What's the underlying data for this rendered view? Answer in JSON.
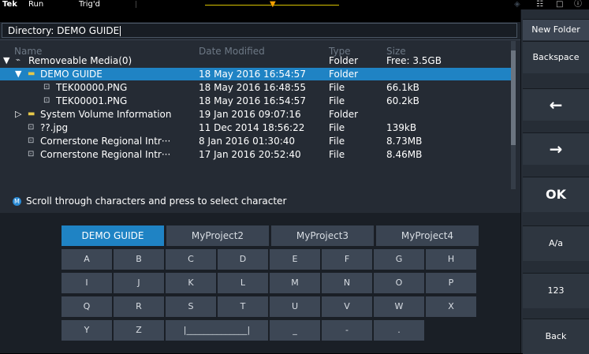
{
  "status_bar": {
    "logo": "Tek",
    "run_state": "Run",
    "trigger_state": "Trig'd",
    "trigger_marker": "T"
  },
  "directory": {
    "label": "Directory: DEMO GUIDE"
  },
  "file_table": {
    "headers": {
      "name": "Name",
      "date": "Date Modified",
      "type": "Type",
      "size": "Size"
    },
    "rows": [
      {
        "name": "Removeable Media(0)",
        "date": "",
        "type": "Folder",
        "size": "Free: 3.5GB",
        "indent": 0,
        "expander": "▼",
        "icon": "drive"
      },
      {
        "name": "DEMO GUIDE",
        "date": "18 May 2016 16:54:57",
        "type": "Folder",
        "size": "",
        "indent": 1,
        "expander": "▼",
        "icon": "folder",
        "selected": true
      },
      {
        "name": "TEK00000.PNG",
        "date": "18 May 2016 16:48:55",
        "type": "File",
        "size": "66.1kB",
        "indent": 2,
        "expander": "",
        "icon": "image"
      },
      {
        "name": "TEK00001.PNG",
        "date": "18 May 2016 16:54:57",
        "type": "File",
        "size": "60.2kB",
        "indent": 2,
        "expander": "",
        "icon": "image"
      },
      {
        "name": "System Volume Information",
        "date": "19 Jan 2016 09:07:16",
        "type": "Folder",
        "size": "",
        "indent": 1,
        "expander": "▷",
        "icon": "folder"
      },
      {
        "name": "??.jpg",
        "date": "11 Dec 2014 18:56:22",
        "type": "File",
        "size": "139kB",
        "indent": 1,
        "expander": "",
        "icon": "image"
      },
      {
        "name": "Cornerstone Regional Intr···",
        "date": "8 Jan 2016 01:30:40",
        "type": "File",
        "size": "8.73MB",
        "indent": 1,
        "expander": "",
        "icon": "image"
      },
      {
        "name": "Cornerstone Regional Intr···",
        "date": "17 Jan 2016 20:52:40",
        "type": "File",
        "size": "8.46MB",
        "indent": 1,
        "expander": "",
        "icon": "image"
      }
    ]
  },
  "hint": {
    "icon": "M",
    "text": "Scroll through characters and press to select character"
  },
  "keyboard": {
    "presets": [
      "DEMO GUIDE",
      "MyProject2",
      "MyProject3",
      "MyProject4"
    ],
    "rows": [
      [
        "A",
        "B",
        "C",
        "D",
        "E",
        "F",
        "G",
        "H"
      ],
      [
        "I",
        "J",
        "K",
        "L",
        "M",
        "N",
        "O",
        "P"
      ],
      [
        "Q",
        "R",
        "S",
        "T",
        "U",
        "V",
        "W",
        "X"
      ],
      [
        "Y",
        "Z",
        "|______________|",
        "_",
        "-",
        "."
      ]
    ]
  },
  "side_menu": {
    "new_folder": "New Folder",
    "backspace": "Backspace",
    "left_arrow": "←",
    "right_arrow": "→",
    "ok": "OK",
    "case": "A/a",
    "numeric": "123",
    "back": "Back"
  },
  "colors": {
    "selection": "#1f83c4",
    "folder_icon": "#e6c84a",
    "trigger": "#f5a000"
  }
}
